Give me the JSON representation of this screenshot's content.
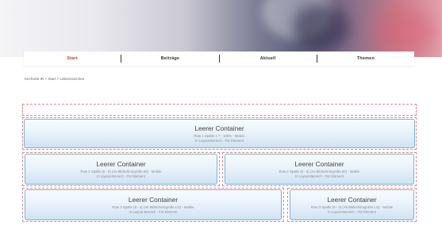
{
  "nav": {
    "items": [
      {
        "label": "Start",
        "active": true
      },
      {
        "label": "Beiträge",
        "active": false
      },
      {
        "label": "Aktuell",
        "active": false
      },
      {
        "label": "Themen",
        "active": false
      }
    ]
  },
  "breadcrumb": "Kirchorte.IR > Start > Lebenszeichen",
  "containers": [
    {
      "title": "Leerer Container",
      "line1": "Row 1 Spalte 1 7 - 100% - Mobile",
      "line2": "In Layout-Bereich - Für Element"
    },
    {
      "title": "Leerer Container",
      "line1": "Row 2 Spalte (6 - 6) (As Bildschirmgröße 50) - Mobile",
      "line2": "In Layout-Bereich - Für Element"
    },
    {
      "title": "Leerer Container",
      "line1": "Row 2 Spalte (6 - 6) (As Bildschirmgröße 50) - Mobile",
      "line2": "In Layout-Bereich - Für Element"
    },
    {
      "title": "Leerer Container",
      "line1": "Row 3 Spalte (8 - 4) (Ab Bildschirmgröße LG) - Mobile",
      "line2": "In Layout-Bereich - Für Element"
    },
    {
      "title": "Leerer Container",
      "line1": "Row 3 Spalte (8 - 4) (Ab Bildschirmgröße LG) - Mobile",
      "line2": "In Layout-Bereich - Für Element"
    }
  ],
  "colors": {
    "active_nav": "#c0392b",
    "dashed_border": "#d98a94",
    "container_border": "#7fb0d8"
  }
}
